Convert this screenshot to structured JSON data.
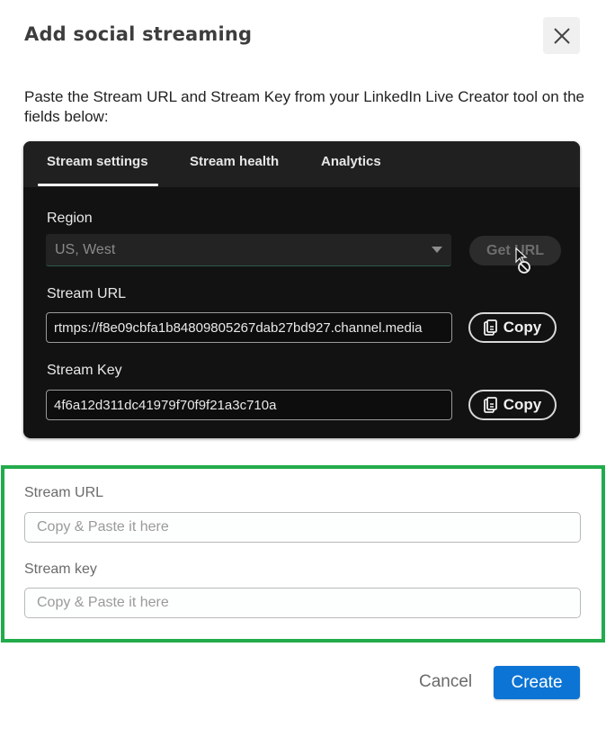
{
  "dialog": {
    "title": "Add social streaming",
    "close_icon": "close-icon",
    "instructions": "Paste the Stream URL and Stream Key from your LinkedIn Live Creator tool on the fields below:"
  },
  "embedded_screenshot": {
    "tabs": [
      {
        "label": "Stream settings",
        "active": true
      },
      {
        "label": "Stream health",
        "active": false
      },
      {
        "label": "Analytics",
        "active": false
      }
    ],
    "region": {
      "label": "Region",
      "selected": "US, West",
      "caret_icon": "caret-down-icon"
    },
    "get_url_button": {
      "label": "Get URL",
      "disabled": true
    },
    "cursor_icon": "not-allowed-cursor-icon",
    "stream_url": {
      "label": "Stream URL",
      "value": "rtmps://f8e09cbfa1b84809805267dab27bd927.channel.media",
      "copy_label": "Copy",
      "copy_icon": "copy-icon"
    },
    "stream_key": {
      "label": "Stream Key",
      "value": "4f6a12d311dc41979f70f9f21a3c710a",
      "copy_label": "Copy",
      "copy_icon": "copy-icon"
    }
  },
  "form": {
    "highlight_color": "#22ab4b",
    "stream_url": {
      "label": "Stream URL",
      "value": "",
      "placeholder": "Copy & Paste it here"
    },
    "stream_key": {
      "label": "Stream key",
      "value": "",
      "placeholder": "Copy & Paste it here"
    }
  },
  "footer": {
    "cancel_label": "Cancel",
    "create_label": "Create",
    "primary_color": "#0c74d4"
  }
}
